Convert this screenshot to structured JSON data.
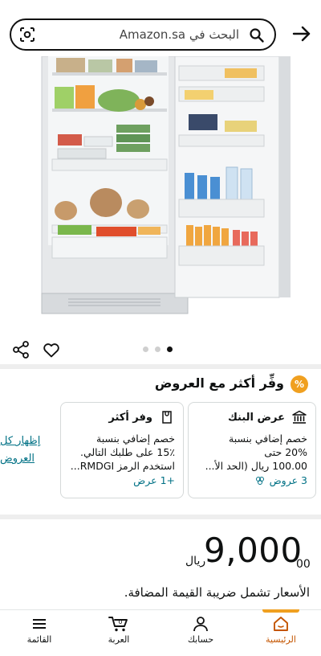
{
  "header": {
    "search_placeholder": "البحث في Amazon.sa"
  },
  "gallery": {
    "image_alt": "",
    "total_images": 3,
    "active_index": 2
  },
  "offers": {
    "badge": "%",
    "title": "وفِّر أكثر مع العروض",
    "cards": [
      {
        "title": "عرض البنك",
        "lines": [
          "خصم إضافي بنسبة",
          "20% حتى",
          "100.00 ريال (الحد الأ..."
        ],
        "link": "3 عروض"
      },
      {
        "title": "وفر أكثر",
        "lines": [
          "خصم إضافي بنسبة",
          "15٪ على طلبك التالي.",
          "استخدم الرمز RMDGI..."
        ],
        "link": "+1 عرض"
      }
    ],
    "show_all_line1": "إظهار كل",
    "show_all_line2": "العروض"
  },
  "price": {
    "currency": "ريال",
    "whole": "9,000",
    "fraction": "00",
    "vat_note": "الأسعار تشمل ضريبة القيمة المضافة."
  },
  "bottom_nav": {
    "home": "الرئيسية",
    "account": "حسابك",
    "cart": "العربة",
    "menu": "القائمة",
    "cart_count": "0"
  },
  "colors": {
    "accent": "#f0a020",
    "link": "#007185",
    "home_active": "#c45500"
  }
}
